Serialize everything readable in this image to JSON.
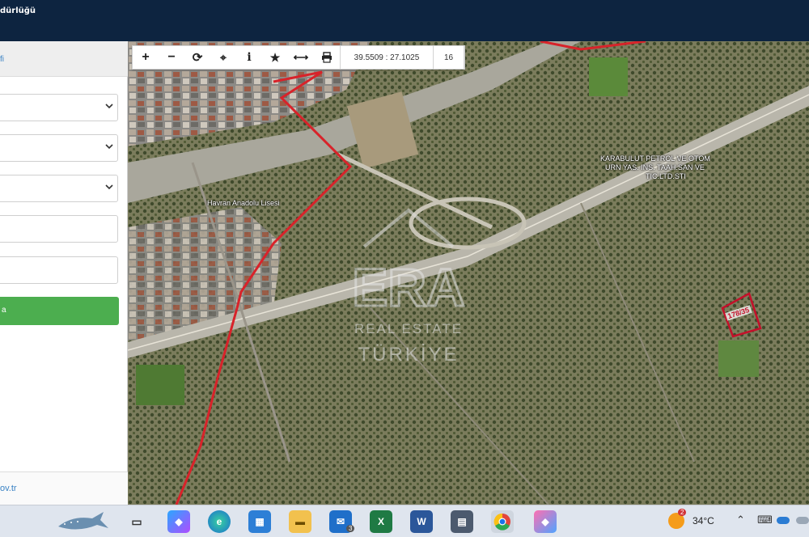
{
  "header": {
    "title": "dürlüğü"
  },
  "sidebar": {
    "link_fragment": "fi",
    "footer_link_fragment": "ov.tr",
    "dropdowns": [
      {
        "value": ""
      },
      {
        "value": ""
      },
      {
        "value": ""
      }
    ],
    "inputs": [
      {
        "value": ""
      },
      {
        "value": ""
      }
    ],
    "query_button_label": "a"
  },
  "map": {
    "toolbar": {
      "coordinates": "39.5509 : 27.1025",
      "zoom_level": "16",
      "tools": [
        "zoom-in",
        "zoom-out",
        "refresh",
        "locate",
        "info",
        "favorite",
        "measure",
        "print"
      ]
    },
    "labels": {
      "school": "Havran Anadolu Lisesi",
      "business_line1": "KARABULUT PETROL VE OTOM",
      "business_line2": "URN YAS. INS. TAAH.SAN VE",
      "business_line3": "TIC.LTD.STI",
      "parcel": "178/35"
    },
    "watermark": {
      "brand": "ERA",
      "line1": "REAL ESTATE",
      "line2": "TÜRKİYE"
    },
    "colors": {
      "boundary": "#d8232a",
      "parcel": "#c4102a"
    }
  },
  "taskbar": {
    "temperature": "34°C",
    "weather_badge": "2",
    "mail_badge": "3",
    "apps": [
      "task-view",
      "copilot",
      "edge",
      "store",
      "file-explorer",
      "mail",
      "excel",
      "word",
      "calculator",
      "chrome",
      "copilot-pro"
    ]
  }
}
